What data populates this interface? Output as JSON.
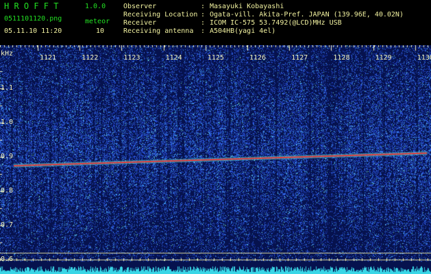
{
  "app": {
    "title": "H R O F F T",
    "version": "1.0.0"
  },
  "file": {
    "name": "0511101120.png",
    "datetime": "05.11.10 11:20"
  },
  "meteor": {
    "label": "meteor",
    "count": "10"
  },
  "info": [
    {
      "key": "Observer",
      "sep": ":",
      "value": "Masayuki Kobayashi"
    },
    {
      "key": "Receiving Location",
      "sep": ":",
      "value": "Ogata-vill. Akita-Pref. JAPAN (139.96E, 40.02N)"
    },
    {
      "key": "Receiver",
      "sep": ":",
      "value": "ICOM IC-575 53.7492(@LCD)MHz USB"
    },
    {
      "key": "Receiving antenna",
      "sep": ":",
      "value": "A504HB(yagi 4el)"
    }
  ],
  "spectrogram": {
    "y_unit": "kHz",
    "y_labels": [
      "1.1",
      "1.0",
      "0.9",
      "0.8",
      "0.7",
      "0.6"
    ],
    "y_range": [
      0.58,
      1.21
    ],
    "time_labels": [
      "1121",
      "1122",
      "1123",
      "1124",
      "1125",
      "1126",
      "1127",
      "1128",
      "1129",
      "1130"
    ],
    "carrier_start_khz": 0.875,
    "carrier_end_khz": 0.912,
    "colors": {
      "background": "#06124e",
      "noise": "#2a4bd8",
      "carrier": "#e83a3a",
      "ticks": "#f5f5c0",
      "guide": "#d8d8a0"
    }
  }
}
